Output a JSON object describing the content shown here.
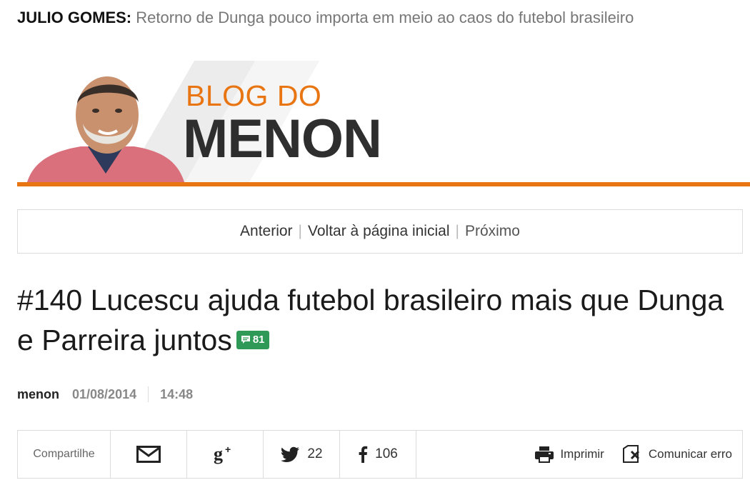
{
  "ticker": {
    "author": "JULIO GOMES:",
    "headline": "Retorno de Dunga pouco importa em meio ao caos do futebol brasileiro"
  },
  "banner": {
    "line1": "BLOG DO",
    "line2": "MENON",
    "accent": "#e87511"
  },
  "pager": {
    "prev": "Anterior",
    "home": "Voltar à página inicial",
    "next": "Próximo",
    "sep": "|"
  },
  "post": {
    "title": "#140 Lucescu ajuda futebol brasileiro mais que Dunga e Parreira juntos",
    "comments": "81",
    "author": "menon",
    "date": "01/08/2014",
    "time": "14:48"
  },
  "share": {
    "label": "Compartilhe",
    "email_icon": "envelope-icon",
    "gplus_icon": "google-plus-icon",
    "twitter_count": "22",
    "facebook_count": "106",
    "print_label": "Imprimir",
    "report_label": "Comunicar erro"
  }
}
